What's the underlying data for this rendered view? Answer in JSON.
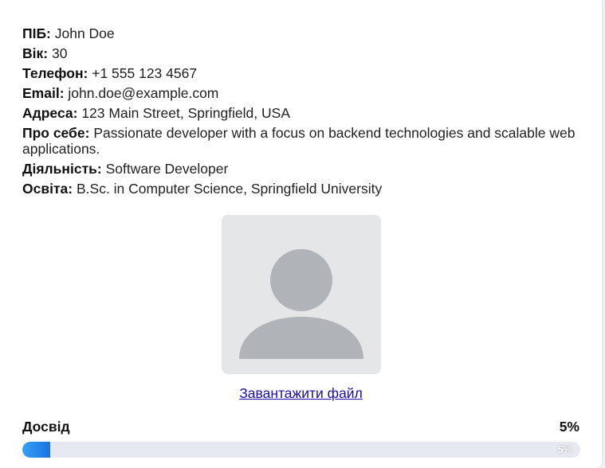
{
  "profile": {
    "name_label": "ПІБ:",
    "name_value": "John Doe",
    "age_label": "Вік:",
    "age_value": "30",
    "phone_label": "Телефон:",
    "phone_value": "+1 555 123 4567",
    "email_label": "Email:",
    "email_value": "john.doe@example.com",
    "address_label": "Адреса:",
    "address_value": "123 Main Street, Springfield, USA",
    "about_label": "Про себе:",
    "about_value": "Passionate developer with a focus on backend technologies and scalable web applications.",
    "activity_label": "Діяльність:",
    "activity_value": "Software Developer",
    "education_label": "Освіта:",
    "education_value": "B.Sc. in Computer Science, Springfield University"
  },
  "photo": {
    "icon": "user-avatar-placeholder-icon",
    "upload_link": "Завантажити файл"
  },
  "experience": {
    "label": "Досвід",
    "value_text": "5%",
    "bar_text": "5%",
    "progress": 0.05
  },
  "colors": {
    "link": "#1a0dab",
    "progress_fill": "#1673e0",
    "progress_track": "#e6e9f2",
    "avatar": "#b0b4b8",
    "photo_bg": "#e5e6e8"
  }
}
